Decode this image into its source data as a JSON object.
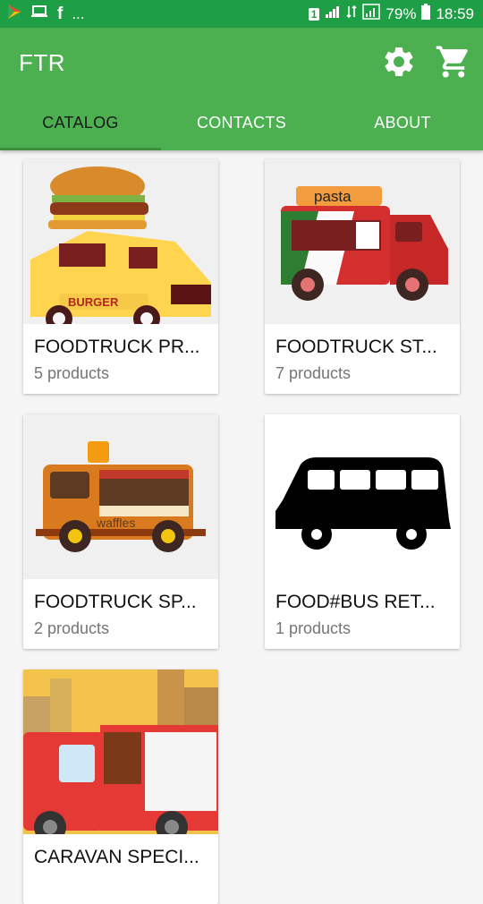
{
  "status_bar": {
    "left_more": "...",
    "battery": "79%",
    "time": "18:59",
    "sim": "1"
  },
  "app": {
    "title": "FTR",
    "settings_icon": "gear-icon",
    "cart_icon": "cart-icon"
  },
  "tabs": [
    {
      "label": "CATALOG",
      "active": true
    },
    {
      "label": "CONTACTS",
      "active": false
    },
    {
      "label": "ABOUT",
      "active": false
    }
  ],
  "catalog": [
    {
      "title": "FOODTRUCK PR...",
      "count": "5 products",
      "image": "burger-truck",
      "badge": "BURGER"
    },
    {
      "title": "FOODTRUCK ST...",
      "count": "7 products",
      "image": "pasta-truck",
      "badge": "pasta"
    },
    {
      "title": "FOODTRUCK SP...",
      "count": "2 products",
      "image": "waffles-truck",
      "badge": "waffles"
    },
    {
      "title": "FOOD#BUS RET...",
      "count": "1 products",
      "image": "bus-silhouette"
    },
    {
      "title": "CARAVAN SPECI...",
      "count": "",
      "image": "caravan-truck"
    }
  ]
}
